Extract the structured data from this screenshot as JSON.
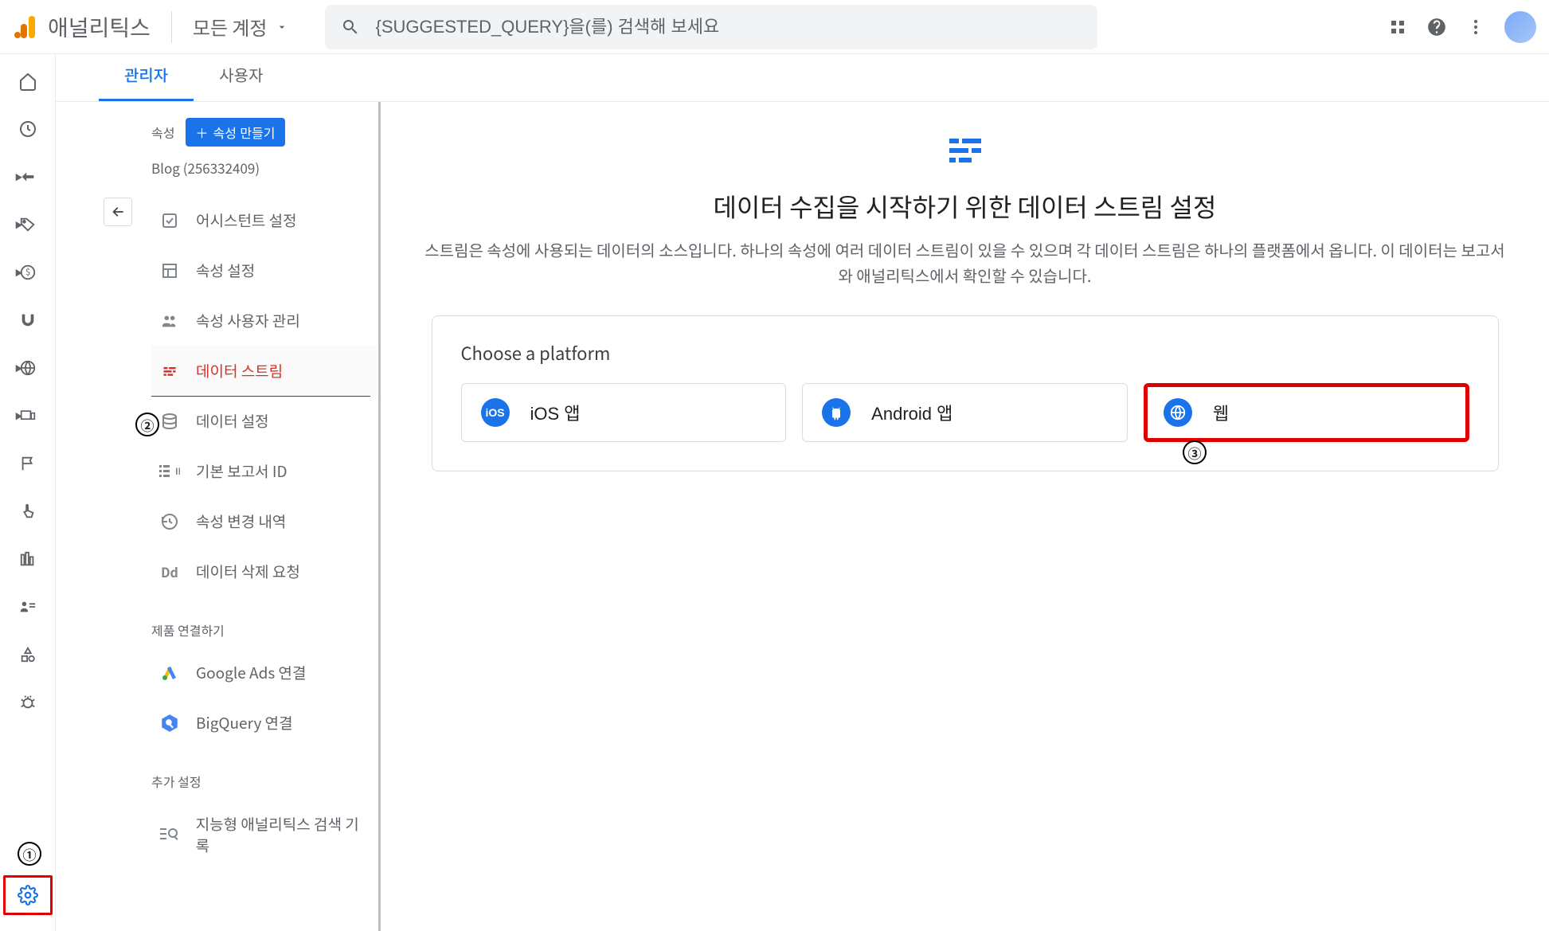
{
  "header": {
    "product_name": "애널리틱스",
    "account_label": "모든 계정",
    "search_placeholder": "{SUGGESTED_QUERY}을(를) 검색해 보세요"
  },
  "tabs": {
    "admin": "관리자",
    "user": "사용자"
  },
  "property": {
    "section_label": "속성",
    "create_button": "속성 만들기",
    "name": "Blog (256332409)",
    "menu": {
      "assistant": "어시스턴트 설정",
      "settings": "속성 설정",
      "users": "속성 사용자 관리",
      "data_streams": "데이터 스트림",
      "data_settings": "데이터 설정",
      "report_id": "기본 보고서 ID",
      "change_history": "속성 변경 내역",
      "data_delete": "데이터 삭제 요청"
    },
    "linking_label": "제품 연결하기",
    "linking": {
      "google_ads": "Google Ads 연결",
      "bigquery": "BigQuery 연결"
    },
    "extra_label": "추가 설정",
    "extra": {
      "search_history": "지능형 애널리틱스 검색 기록"
    }
  },
  "main": {
    "title": "데이터 수집을 시작하기 위한 데이터 스트림 설정",
    "description": "스트림은 속성에 사용되는 데이터의 소스입니다. 하나의 속성에 여러 데이터 스트림이 있을 수 있으며 각 데이터 스트림은 하나의 플랫폼에서 옵니다. 이 데이터는 보고서와 애널리틱스에서 확인할 수 있습니다.",
    "platform_heading": "Choose a platform",
    "platforms": {
      "ios": "iOS 앱",
      "android": "Android 앱",
      "web": "웹"
    }
  },
  "annotations": {
    "one": "①",
    "two": "②",
    "three": "③"
  }
}
